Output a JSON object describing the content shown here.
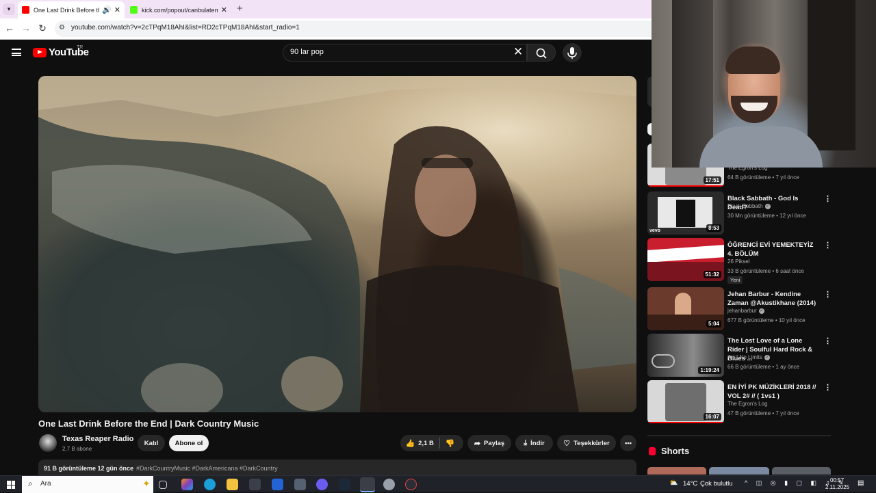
{
  "browser": {
    "tabs": [
      {
        "title": "One Last Drink Before the E",
        "favicon_color": "#ff0000"
      },
      {
        "title": "kick.com/popout/canbulatemre/",
        "favicon_color": "#53fc18"
      }
    ],
    "url": "youtube.com/watch?v=2cTPqM18AhI&list=RD2cTPqM18AhI&start_radio=1"
  },
  "youtube": {
    "logo_text": "YouTube",
    "country_code": "TR",
    "search_value": "90 lar pop"
  },
  "video": {
    "title": "One Last Drink Before the End | Dark Country Music",
    "channel": "Texas Reaper Radio",
    "subscribers": "2,7 B abone",
    "join_label": "Katıl",
    "subscribe_label": "Abone ol",
    "likes": "2,1 B",
    "share_label": "Paylaş",
    "download_label": "İndir",
    "thanks_label": "Teşekkürler",
    "views_age": "91 B görüntüleme  12 gün önce",
    "hashtags": "#DarkCountryMusic #DarkAmericana #DarkCountry"
  },
  "recommendations": [
    {
      "title": "",
      "channel": "The Egron's Log",
      "meta": "64 B görüntüleme • 7 yıl önce",
      "duration": "17:51",
      "progress": 1.0,
      "thumb_color": "#dcdcdc"
    },
    {
      "title": "Black Sabbath - God Is Dead?",
      "channel": "Black Sabbath",
      "meta": "30 Mn görüntüleme • 12 yıl önce",
      "duration": "8:53",
      "progress": 0.0,
      "thumb_color": "#2a2a2a"
    },
    {
      "title": "ÖĞRENCİ EVİ YEMEKTEYİZ 4. BÖLÜM",
      "channel": "26 Piksel",
      "meta": "33 B görüntüleme • 6 saat önce",
      "badge": "Yeni",
      "duration": "51:32",
      "progress": 0.0,
      "thumb_color": "#c81e2e"
    },
    {
      "title": "Jehan Barbur - Kendine Zaman @Akustikhane (2014)",
      "channel": "jehanbarbur",
      "meta": "677 B görüntüleme • 10 yıl önce",
      "duration": "5:04",
      "progress": 0.0,
      "thumb_color": "#6a3a2c"
    },
    {
      "title": "The Lost Love of a Lone Rider | Soulful Hard Rock & Blues ...",
      "channel": "Ain't No Limits",
      "meta": "66 B görüntüleme • 1 ay önce",
      "duration": "1:19:24",
      "progress": 0.0,
      "thumb_color": "#5a5a5a"
    },
    {
      "title": "EN İYİ PK MÜZİKLERİ 2018 // VOL 2# // ( 1vs1 )",
      "channel": "The Egron's Log",
      "meta": "47 B görüntüleme • 7 yıl önce",
      "duration": "16:07",
      "progress": 1.0,
      "thumb_color": "#d8d8d8"
    }
  ],
  "shorts": {
    "title": "Shorts"
  },
  "taskbar": {
    "search_text": "Ara",
    "temperature": "14°C",
    "weather": "Çok bulutlu",
    "time": "00:57",
    "date": "2.11.2025"
  }
}
